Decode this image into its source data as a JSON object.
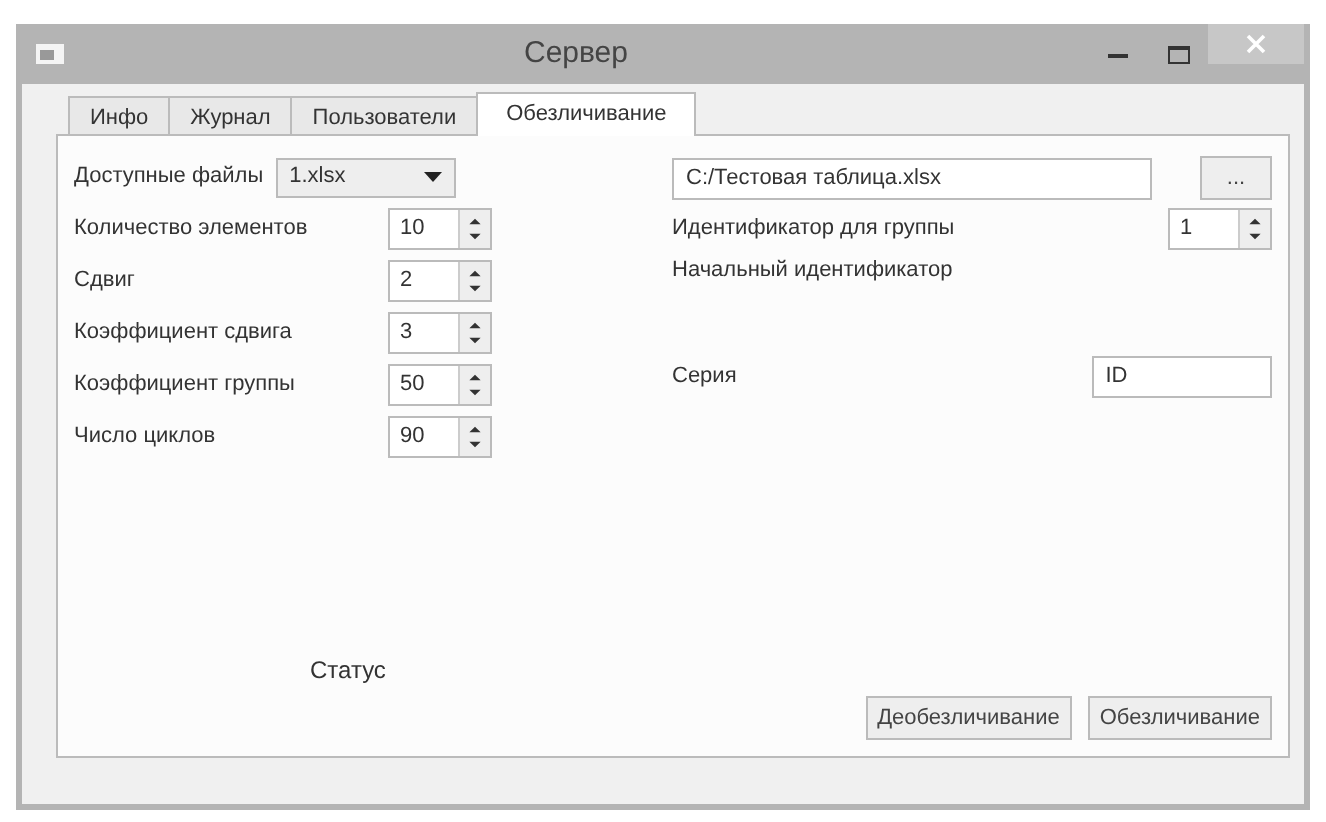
{
  "window": {
    "title": "Сервер"
  },
  "tabs": [
    {
      "label": "Инфо",
      "selected": false
    },
    {
      "label": "Журнал",
      "selected": false
    },
    {
      "label": "Пользователи",
      "selected": false
    },
    {
      "label": "Обезличивание",
      "selected": true
    }
  ],
  "left_fields": [
    {
      "kind": "combo",
      "label": "Доступные файлы",
      "value": "1.xlsx"
    },
    {
      "kind": "spin",
      "label": "Количество элементов",
      "value": "10"
    },
    {
      "kind": "spin",
      "label": "Сдвиг",
      "value": "2"
    },
    {
      "kind": "spin",
      "label": "Коэффициент сдвига",
      "value": "3"
    },
    {
      "kind": "spin",
      "label": "Коэффициент группы",
      "value": "50"
    },
    {
      "kind": "spin",
      "label": "Число циклов",
      "value": "90"
    }
  ],
  "file_path": {
    "value": "C:/Тестовая таблица.xlsx",
    "browse_button": "..."
  },
  "group_id": {
    "label": "Идентификатор для группы",
    "value": "1"
  },
  "start_id_label": "Начальный идентификатор",
  "series": {
    "label": "Серия",
    "value": "ID"
  },
  "status": "Статус",
  "buttons": [
    "Деобезличивание",
    "Обезличивание"
  ]
}
